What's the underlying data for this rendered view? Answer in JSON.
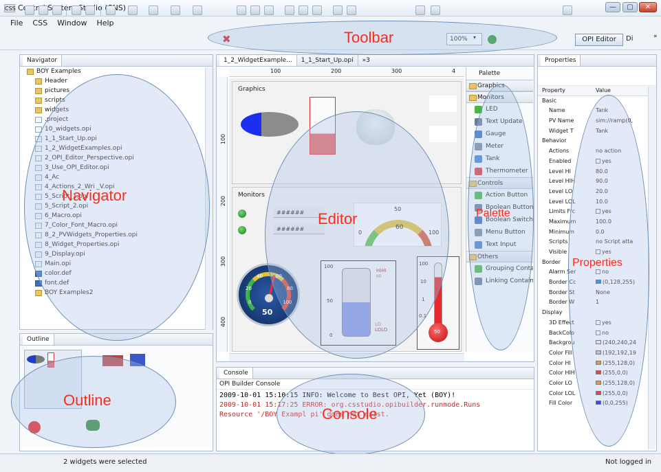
{
  "window": {
    "title": "Control System Studio (SNS)",
    "app_icon": "CSS",
    "btn_min": "—",
    "btn_max": "▢",
    "btn_close": "✕"
  },
  "menu": [
    "File",
    "CSS",
    "Window",
    "Help"
  ],
  "toolbar": {
    "zoom": "100%",
    "opi_editor": "OPI Editor",
    "di_label": "Di",
    "overflow": "»",
    "caret": "▾"
  },
  "annotations": {
    "toolbar": "Toolbar",
    "navigator": "Navigator",
    "editor": "Editor",
    "palette": "Palette",
    "properties": "Properties",
    "outline": "Outline",
    "console": "Console"
  },
  "navigator": {
    "tab": "Navigator",
    "root": "BOY Examples",
    "items": [
      {
        "label": "Header",
        "type": "folder"
      },
      {
        "label": "pictures",
        "type": "folder"
      },
      {
        "label": "scripts",
        "type": "folder"
      },
      {
        "label": "widgets",
        "type": "folder"
      },
      {
        "label": ".project",
        "type": "file"
      },
      {
        "label": "10_widgets.opi",
        "type": "file"
      },
      {
        "label": "1_1_Start_Up.opi",
        "type": "file"
      },
      {
        "label": "1_2_WidgetExamples.opi",
        "type": "file"
      },
      {
        "label": "2_OPI_Editor_Perspective.opi",
        "type": "file"
      },
      {
        "label": "3_Use_OPI_Editor.opi",
        "type": "file"
      },
      {
        "label": "4_Ac",
        "type": "file"
      },
      {
        "label": "4_Actions_2_Wri  _V.opi",
        "type": "file"
      },
      {
        "label": "5_Script_1.opi",
        "type": "file"
      },
      {
        "label": "5_Script_2.opi",
        "type": "file"
      },
      {
        "label": "6_Macro.opi",
        "type": "file"
      },
      {
        "label": "7_Color_Font_Macro.opi",
        "type": "file"
      },
      {
        "label": "8_2_PVWidgets_Properties.opi",
        "type": "file"
      },
      {
        "label": "8_Widget_Properties.opi",
        "type": "file"
      },
      {
        "label": "9_Display.opi",
        "type": "file"
      },
      {
        "label": "Main.opi",
        "type": "file"
      },
      {
        "label": "color.def",
        "type": "def"
      },
      {
        "label": "font.def",
        "type": "def"
      },
      {
        "label": "BOY Examples2",
        "type": "folder"
      }
    ]
  },
  "outline": {
    "tab": "Outline"
  },
  "editor": {
    "tabs": [
      "1_2_WidgetExample...",
      "1_1_Start_Up.opi"
    ],
    "tab_overflow": "»3",
    "ruler_top": [
      "100",
      "200",
      "300",
      "4"
    ],
    "ruler_left": [
      "100",
      "200",
      "300",
      "400"
    ],
    "sections": {
      "graphics": "Graphics",
      "monitors": "Monitors"
    },
    "monitors": {
      "hash1": "######",
      "hash2": "######",
      "meter_top": "50",
      "meter_left": "0",
      "meter_right": "100",
      "meter_mid": "60"
    },
    "gauge_value": "50",
    "gauge_ticks": [
      "0",
      "20",
      "40",
      "60",
      "80",
      "100"
    ],
    "tank": {
      "hihi": "HIHI",
      "hi": "HI",
      "lo": "LO",
      "lolo": "LOLO",
      "t100": "100",
      "t50": "50",
      "t0": "0"
    },
    "thermo": {
      "t100": "100",
      "t10": "10",
      "t1": "1",
      "t01": "0.1",
      "value": "50"
    },
    "palette": {
      "title": "Palette",
      "categories": [
        "Graphics",
        "Monitors",
        "Controls",
        "Others"
      ],
      "monitors": [
        "LED",
        "Text Update",
        "Gauge",
        "Meter",
        "Tank",
        "Thermometer"
      ],
      "controls": [
        "Action Button",
        "Boolean Button",
        "Boolean Switch",
        "Menu Button",
        "Text Input"
      ],
      "others": [
        "Grouping Container",
        "Linking Container"
      ]
    }
  },
  "properties": {
    "tab": "Properties",
    "col_property": "Property",
    "col_value": "Value",
    "rows": [
      {
        "k": "Basic",
        "v": "",
        "cat": true
      },
      {
        "k": "Name",
        "v": "Tank"
      },
      {
        "k": "PV Name",
        "v": "sim://ramp(0,"
      },
      {
        "k": "Widget T",
        "v": "Tank"
      },
      {
        "k": "Behavior",
        "v": "",
        "cat": true
      },
      {
        "k": "Actions",
        "v": "no action"
      },
      {
        "k": "Enabled",
        "v": "yes",
        "check": true
      },
      {
        "k": "Level HI",
        "v": "80.0"
      },
      {
        "k": "Level HIH",
        "v": "90.0"
      },
      {
        "k": "Level LO",
        "v": "20.0"
      },
      {
        "k": "Level LOL",
        "v": "10.0"
      },
      {
        "k": "Limits Frc",
        "v": "yes",
        "check": true
      },
      {
        "k": "Maximum",
        "v": "100.0"
      },
      {
        "k": "Minimum",
        "v": "0.0"
      },
      {
        "k": "Scripts",
        "v": "no Script atta"
      },
      {
        "k": "Visible",
        "v": "yes",
        "check": true
      },
      {
        "k": "Border",
        "v": "",
        "cat": true
      },
      {
        "k": "Alarm Ser",
        "v": "no",
        "check": true
      },
      {
        "k": "Border Cc",
        "v": "(0,128,255)",
        "color": "#0080ff"
      },
      {
        "k": "Border St",
        "v": "None"
      },
      {
        "k": "Border W",
        "v": "1"
      },
      {
        "k": "Display",
        "v": "",
        "cat": true
      },
      {
        "k": "3D Effect",
        "v": "yes",
        "check": true
      },
      {
        "k": "BackColo",
        "v": "no",
        "check": true
      },
      {
        "k": "Backgrou",
        "v": "(240,240,24",
        "color": "#f0f0f0"
      },
      {
        "k": "Color Fill",
        "v": "(192,192,19",
        "color": "#c0c0c0"
      },
      {
        "k": "Color HI",
        "v": "(255,128,0)",
        "color": "#ff8000"
      },
      {
        "k": "Color HIH",
        "v": "(255,0,0)",
        "color": "#ff0000"
      },
      {
        "k": "Color LO",
        "v": "(255,128,0)",
        "color": "#ff8000"
      },
      {
        "k": "Color LOL",
        "v": "(255,0,0)",
        "color": "#ff0000"
      },
      {
        "k": "Fill Color",
        "v": "(0,0,255)",
        "color": "#0000ff"
      }
    ]
  },
  "console": {
    "tab": "Console",
    "header": "OPI Builder Console",
    "lines": [
      {
        "text": "2009-10-01 15:10:15 INFO: Welcome to Best OPI, Yet (BOY)!",
        "color": "#000000"
      },
      {
        "text": "2009-10-01 15:17:25 ERROR: org.csstudio.opibuilder.runmode.Runs",
        "color": "#d42020"
      },
      {
        "text": "Resource '/BOY Exampl       pi' does not exist.",
        "color": "#d42020"
      }
    ]
  },
  "status": {
    "message": "2 widgets were selected",
    "login": "Not logged in"
  }
}
